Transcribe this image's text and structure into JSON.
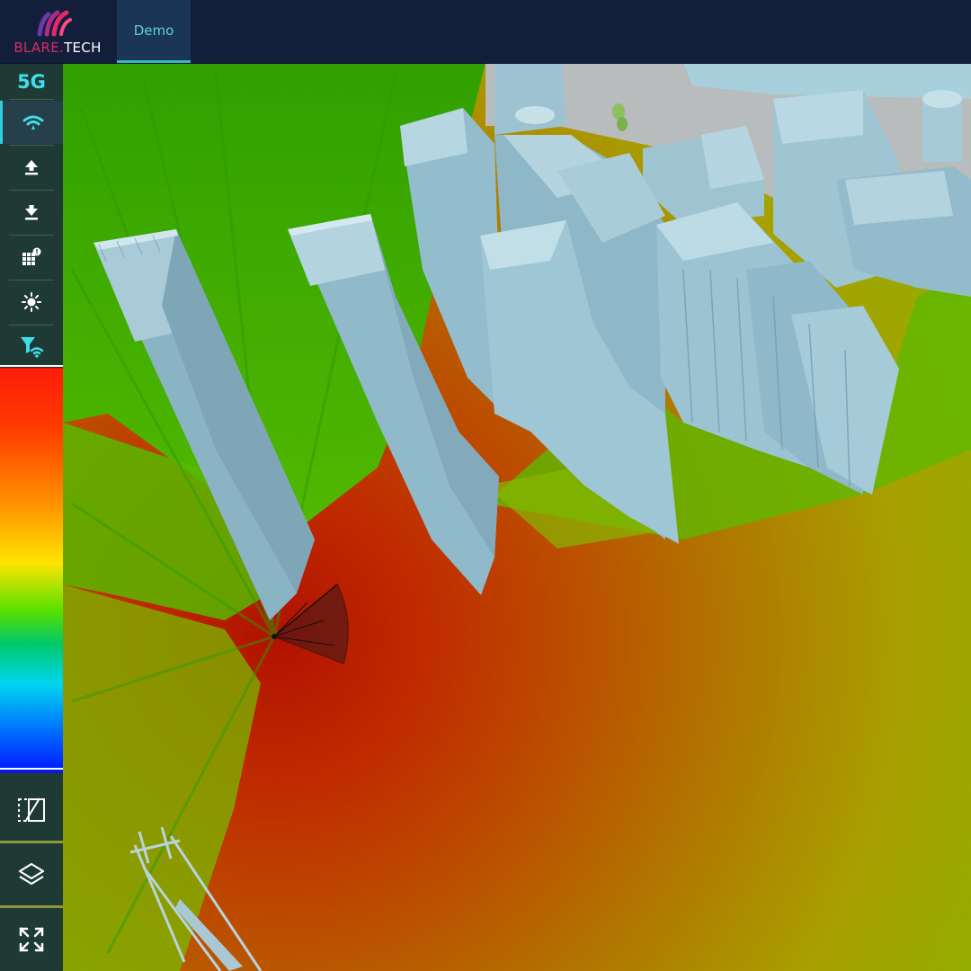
{
  "app": {
    "logo": {
      "brand": "BLARE",
      "dot": ".",
      "tech": "TECH"
    },
    "tabs": [
      {
        "label": "Demo",
        "active": true
      }
    ]
  },
  "sidebar": {
    "network_label": "5G",
    "tools": [
      {
        "icon": "signal-wifi-icon",
        "active": true
      },
      {
        "icon": "upload-icon",
        "active": false
      },
      {
        "icon": "download-icon",
        "active": false
      },
      {
        "icon": "grid-alert-icon",
        "active": false
      },
      {
        "icon": "sun-icon",
        "active": false
      },
      {
        "icon": "filter-signal-icon",
        "active": false
      }
    ],
    "bottom_tools": [
      {
        "icon": "measure-area-icon"
      },
      {
        "icon": "layers-icon"
      },
      {
        "icon": "fullscreen-icon"
      }
    ]
  },
  "colors": {
    "accent": "#2fd0dc",
    "brand_pink": "#d82a6a",
    "topbar": "#131f3a",
    "sidebar": "#1f3a35",
    "building": "#8fb6c6",
    "ground": "#b9bcbc"
  },
  "heatmap": {
    "scale": [
      "#ff1c0a",
      "#ff8f00",
      "#ffe500",
      "#56e000",
      "#00c96a",
      "#00d4f0",
      "#0014ff"
    ]
  }
}
